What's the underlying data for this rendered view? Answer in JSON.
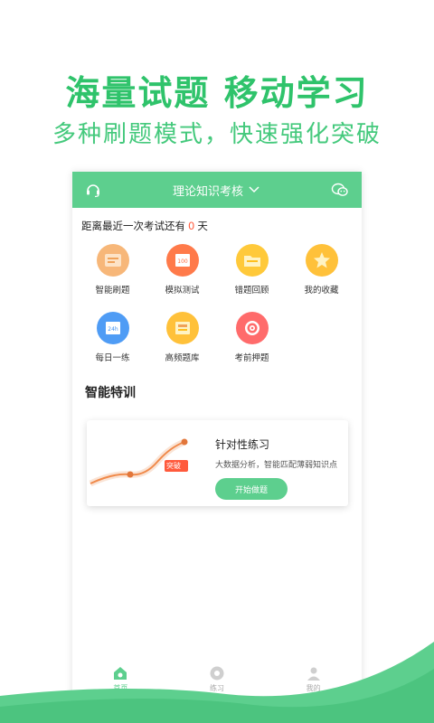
{
  "promo": {
    "title": "海量试题 移动学习",
    "subtitle": "多种刷题模式，快速强化突破"
  },
  "header": {
    "title": "理论知识考核",
    "left_icon": "headset-icon",
    "right_icon": "wechat-icon"
  },
  "countdown": {
    "prefix": "距离最近一次考试还有",
    "days": "0",
    "suffix": "天"
  },
  "grid": {
    "items": [
      {
        "label": "智能刷题",
        "icon": "smart-practice-icon",
        "color": "#f0a259"
      },
      {
        "label": "模拟测试",
        "icon": "mock-test-icon",
        "color": "#ff6b3d"
      },
      {
        "label": "错题回顾",
        "icon": "wrong-review-icon",
        "color": "#ffbf1f"
      },
      {
        "label": "我的收藏",
        "icon": "favorite-icon",
        "color": "#ffb81e"
      },
      {
        "label": "每日一练",
        "icon": "daily-practice-icon",
        "color": "#3d8ff0"
      },
      {
        "label": "高频题库",
        "icon": "frequent-bank-icon",
        "color": "#ffb81e"
      },
      {
        "label": "考前押题",
        "icon": "target-icon",
        "color": "#ff5a5a"
      }
    ]
  },
  "section": {
    "title": "智能特训"
  },
  "card": {
    "title": "针对性练习",
    "desc": "大数据分析，智能匹配薄弱知识点",
    "button": "开始做题",
    "badge": "突破"
  },
  "tabbar": {
    "items": [
      {
        "label": "首页",
        "icon": "home-icon"
      },
      {
        "label": "练习",
        "icon": "practice-icon"
      },
      {
        "label": "我的",
        "icon": "profile-icon"
      }
    ]
  },
  "colors": {
    "accent": "#5dcf8e",
    "promo_green": "#2fc36b",
    "highlight": "#ff5a3c"
  }
}
